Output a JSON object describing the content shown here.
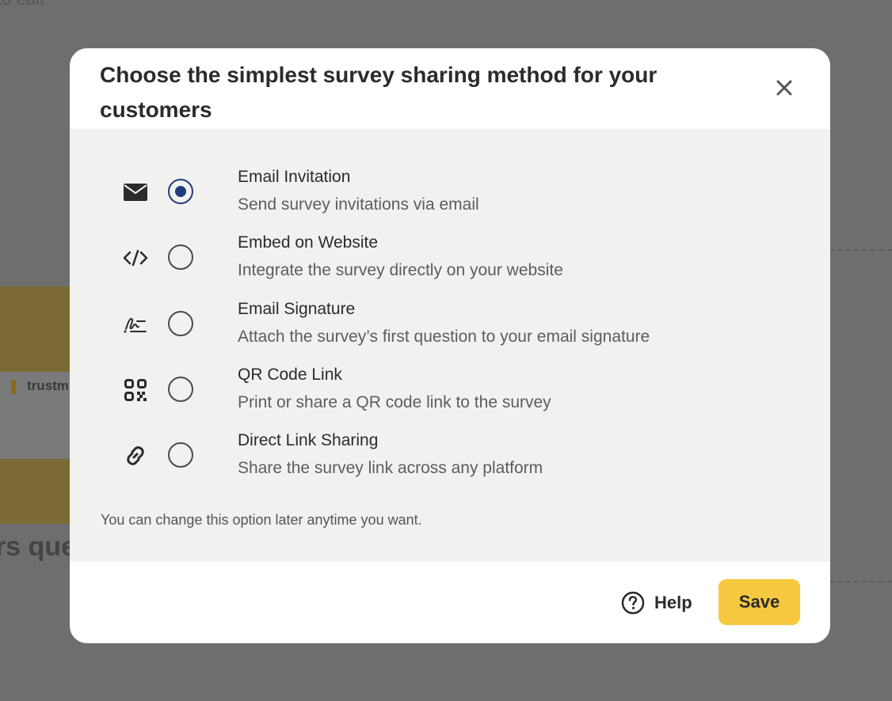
{
  "background": {
    "top_text": "to edit",
    "brand": "trustm",
    "heading": "rs que"
  },
  "modal": {
    "title": "Choose the simplest survey sharing method for your customers",
    "close_icon": "close-icon",
    "options": [
      {
        "icon": "envelope-icon",
        "title": "Email Invitation",
        "description": "Send survey invitations via email",
        "selected": true
      },
      {
        "icon": "code-icon",
        "title": "Embed on Website",
        "description": "Integrate the survey directly on your website",
        "selected": false
      },
      {
        "icon": "signature-icon",
        "title": "Email Signature",
        "description": "Attach the survey’s first question to your email signature",
        "selected": false
      },
      {
        "icon": "qr-code-icon",
        "title": "QR Code Link",
        "description": "Print or share a QR code link to the survey",
        "selected": false
      },
      {
        "icon": "link-icon",
        "title": "Direct Link Sharing",
        "description": "Share the survey link across any platform",
        "selected": false
      }
    ],
    "note": "You can change this option later anytime you want.",
    "footer": {
      "help_label": "Help",
      "save_label": "Save"
    }
  },
  "colors": {
    "accent": "#f6c83f",
    "radio_selected": "#1f3b7a",
    "body_bg": "#f1f1ef",
    "overlay": "#6e6e6e"
  }
}
